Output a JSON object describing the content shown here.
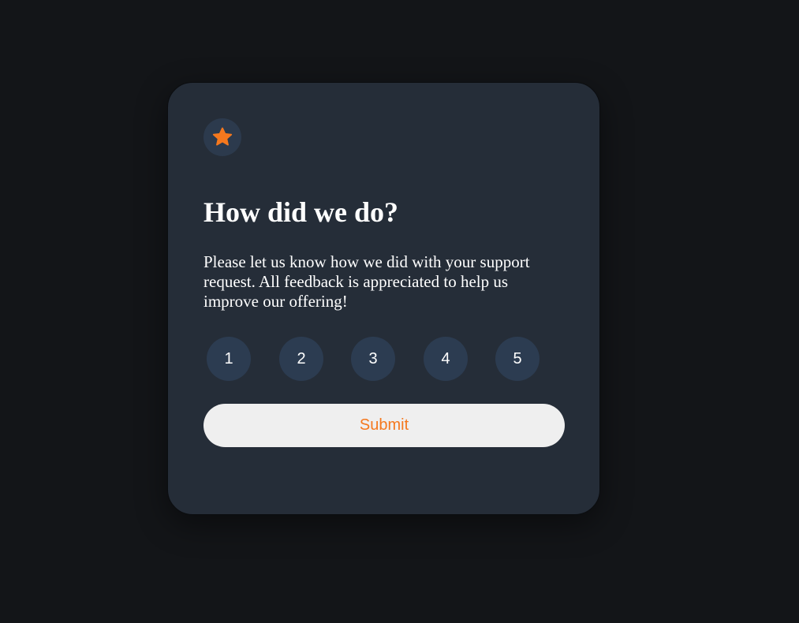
{
  "card": {
    "icon": "star-icon",
    "title": "How did we do?",
    "description": "Please let us know how we did with your support request. All feedback is appreciated to help us improve our offering!",
    "ratings": [
      "1",
      "2",
      "3",
      "4",
      "5"
    ],
    "submit_label": "Submit"
  },
  "colors": {
    "page_background": "#131518",
    "card_background": "#252d38",
    "icon_badge_background": "#2c3a4d",
    "rating_button_background": "#2c3c51",
    "accent": "#f5781e",
    "submit_background": "#efefef",
    "text": "#ffffff"
  }
}
